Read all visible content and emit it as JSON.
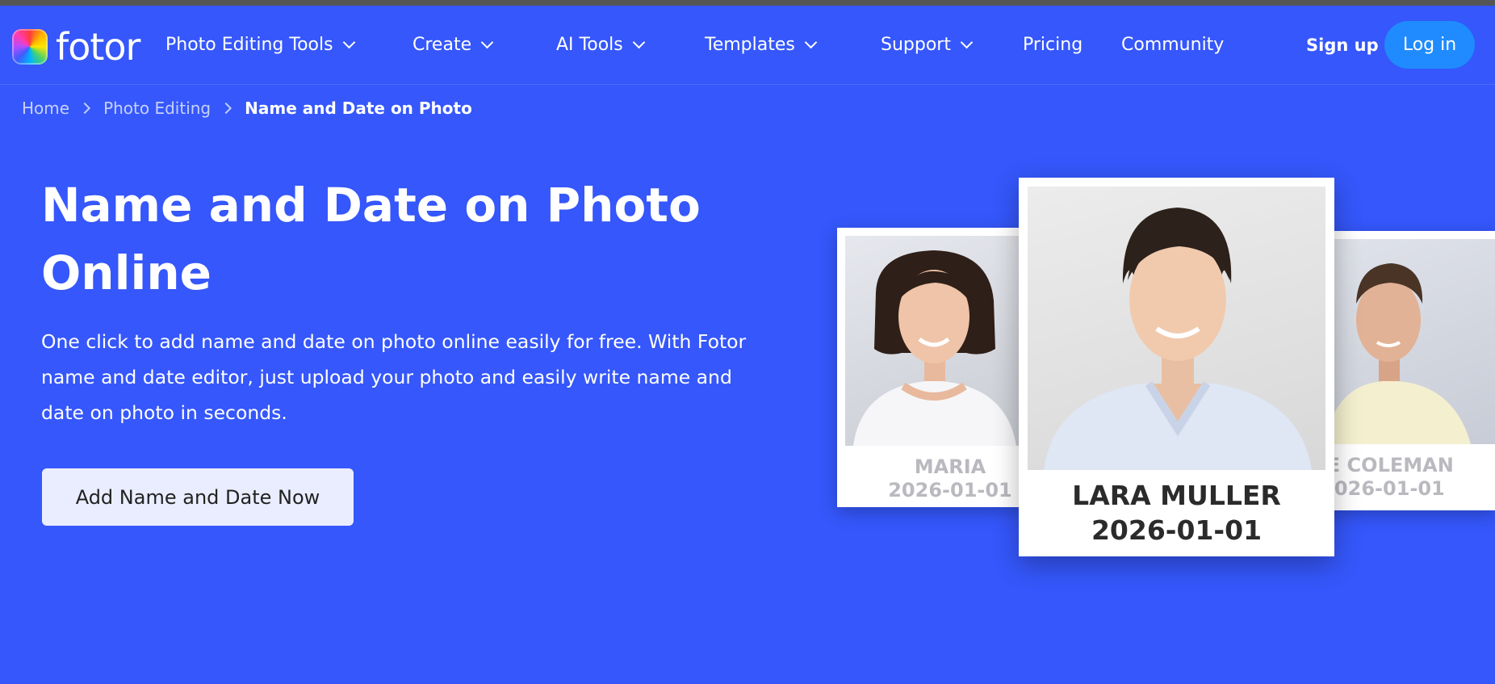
{
  "logo": {
    "text": "fotor"
  },
  "nav": {
    "items": [
      {
        "label": "Photo Editing Tools",
        "has_dropdown": true
      },
      {
        "label": "Create",
        "has_dropdown": true
      },
      {
        "label": "AI Tools",
        "has_dropdown": true
      },
      {
        "label": "Templates",
        "has_dropdown": true
      },
      {
        "label": "Support",
        "has_dropdown": true
      },
      {
        "label": "Pricing",
        "has_dropdown": false
      },
      {
        "label": "Community",
        "has_dropdown": false
      }
    ],
    "signup_label": "Sign up",
    "login_label": "Log in"
  },
  "breadcrumb": {
    "items": [
      "Home",
      "Photo Editing",
      "Name and Date on Photo"
    ]
  },
  "hero": {
    "title": "Name and Date on Photo Online",
    "description": "One click to add name and date on photo online easily for free. With Fotor name and date editor, just upload your photo and easily write name and date on photo in seconds.",
    "cta_label": "Add Name and Date Now"
  },
  "cards": {
    "left": {
      "name": "MARIA",
      "date": "2026-01-01"
    },
    "main": {
      "name": "LARA MULLER",
      "date": "2026-01-01"
    },
    "right": {
      "name": "KE COLEMAN",
      "date": "2026-01-01"
    }
  },
  "colors": {
    "background": "#3557fb",
    "login_button": "#1f8bff",
    "cta_background": "#eaedff"
  }
}
